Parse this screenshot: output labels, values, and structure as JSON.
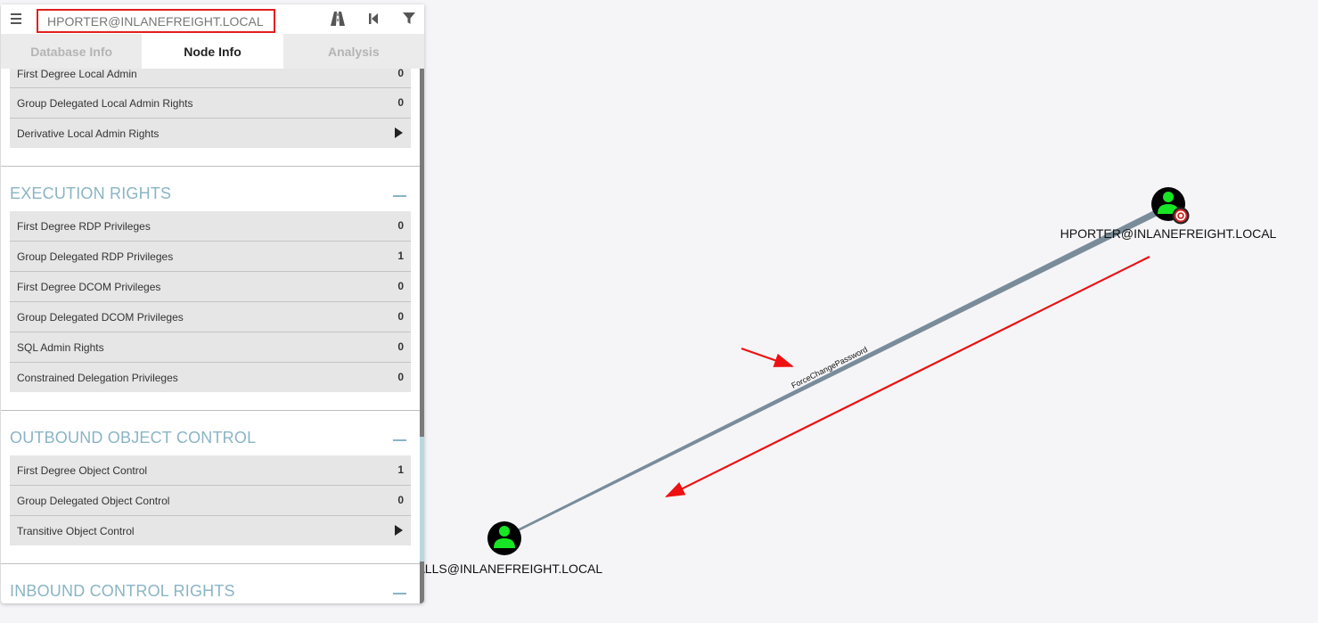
{
  "search": {
    "value": "HPORTER@INLANEFREIGHT.LOCAL"
  },
  "toolbar": {
    "menu_icon": "hamburger-menu-icon",
    "pathfinding_icon": "road-icon",
    "back_icon": "skip-back-icon",
    "filter_icon": "filter-icon"
  },
  "tabs": [
    {
      "label": "Database Info",
      "active": false
    },
    {
      "label": "Node Info",
      "active": true
    },
    {
      "label": "Analysis",
      "active": false
    }
  ],
  "local_admin": {
    "rows": [
      {
        "label": "First Degree Local Admin",
        "value": "0"
      },
      {
        "label": "Group Delegated Local Admin Rights",
        "value": "0"
      },
      {
        "label": "Derivative Local Admin Rights",
        "value": ""
      }
    ]
  },
  "execution_rights": {
    "title": "EXECUTION RIGHTS",
    "rows": [
      {
        "label": "First Degree RDP Privileges",
        "value": "0"
      },
      {
        "label": "Group Delegated RDP Privileges",
        "value": "1"
      },
      {
        "label": "First Degree DCOM Privileges",
        "value": "0"
      },
      {
        "label": "Group Delegated DCOM Privileges",
        "value": "0"
      },
      {
        "label": "SQL Admin Rights",
        "value": "0"
      },
      {
        "label": "Constrained Delegation Privileges",
        "value": "0"
      }
    ]
  },
  "outbound_control": {
    "title": "OUTBOUND OBJECT CONTROL",
    "rows": [
      {
        "label": "First Degree Object Control",
        "value": "1"
      },
      {
        "label": "Group Delegated Object Control",
        "value": "0"
      },
      {
        "label": "Transitive Object Control",
        "value": ""
      }
    ]
  },
  "inbound_control": {
    "title": "INBOUND CONTROL RIGHTS"
  },
  "graph": {
    "source_node": {
      "label": "HPORTER@INLANEFREIGHT.LOCAL",
      "icon": "user-icon",
      "badge": "target-icon"
    },
    "target_node": {
      "label": "MALLS@INLANEFREIGHT.LOCAL",
      "icon": "user-icon"
    },
    "edge": {
      "label": "ForceChangePassword"
    },
    "colors": {
      "node_fill": "#000000",
      "user_glyph": "#17e625",
      "edge": "#7a8c99",
      "annotation": "#ee1111",
      "section_title": "#8ab4c6"
    }
  }
}
